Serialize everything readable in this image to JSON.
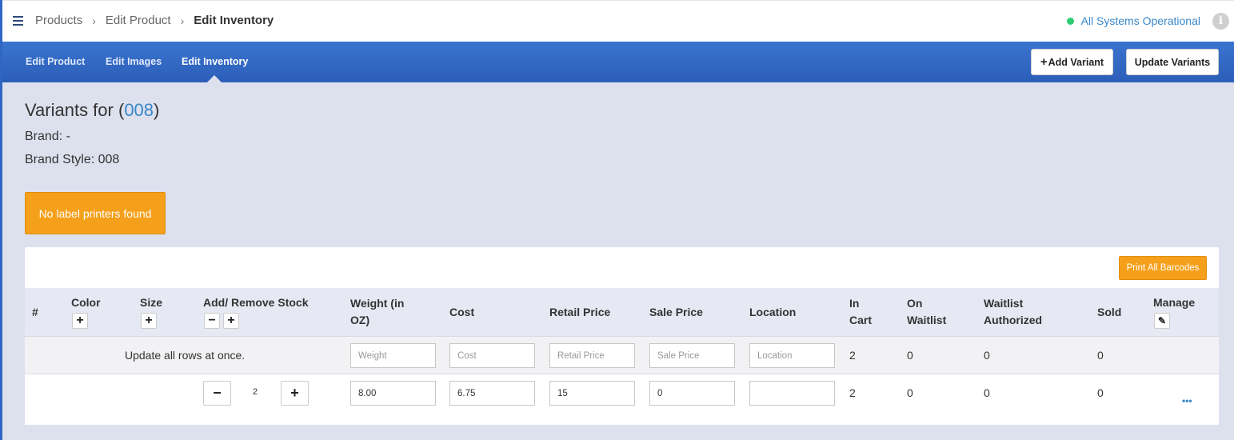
{
  "breadcrumb": {
    "items": [
      "Products",
      "Edit Product"
    ],
    "current": "Edit Inventory",
    "separator": "›"
  },
  "status": {
    "text": "All Systems Operational",
    "color": "#2ecc71"
  },
  "info_icon": "info-circle-icon",
  "tabs": [
    {
      "label": "Edit Product",
      "active": false
    },
    {
      "label": "Edit Images",
      "active": false
    },
    {
      "label": "Edit Inventory",
      "active": true
    }
  ],
  "actions": {
    "add_variant": "Add Variant",
    "update_variants": "Update Variants",
    "add_icon": "+"
  },
  "page": {
    "title_prefix": "Variants for (",
    "title_link": "008",
    "title_suffix": ")",
    "brand": "Brand: -",
    "brand_style": "Brand Style: 008"
  },
  "alert": {
    "text": "No label printers found"
  },
  "print_button": "Print All Barcodes",
  "table": {
    "headers": {
      "num": "#",
      "color": "Color",
      "size": "Size",
      "stock": "Add/ Remove Stock",
      "weight_1": "Weight (in",
      "weight_2": "OZ)",
      "cost": "Cost",
      "retail": "Retail Price",
      "sale": "Sale Price",
      "location": "Location",
      "in_cart_1": "In",
      "in_cart_2": "Cart",
      "waitlist_1": "On",
      "waitlist_2": "Waitlist",
      "auth_1": "Waitlist",
      "auth_2": "Authorized",
      "sold": "Sold",
      "manage": "Manage"
    },
    "bulk_row": {
      "label": "Update all rows at once.",
      "placeholders": {
        "weight": "Weight",
        "cost": "Cost",
        "retail": "Retail Price",
        "sale": "Sale Price",
        "location": "Location"
      },
      "in_cart": "2",
      "on_waitlist": "0",
      "authorized": "0",
      "sold": "0"
    },
    "rows": [
      {
        "stock": "2",
        "weight": "8.00",
        "cost": "6.75",
        "retail": "15",
        "sale": "0",
        "location": "",
        "in_cart": "2",
        "on_waitlist": "0",
        "authorized": "0",
        "sold": "0",
        "more": "•••"
      }
    ]
  },
  "symbols": {
    "plus": "+",
    "minus": "−",
    "pencil": "✎"
  }
}
